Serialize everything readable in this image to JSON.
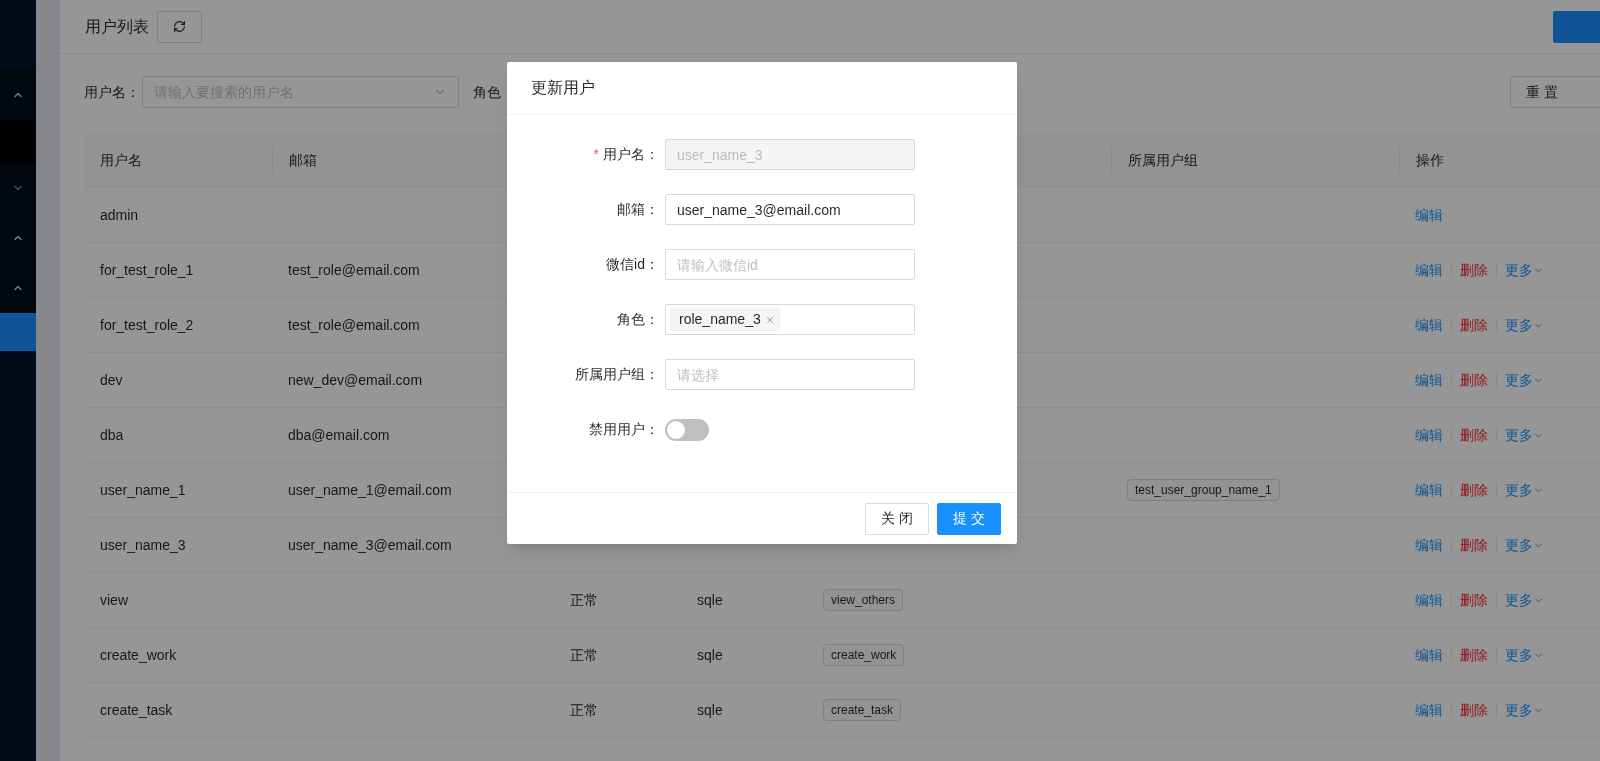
{
  "sidebar": {
    "items": [
      {
        "kind": "submenu",
        "expanded": true
      },
      {
        "kind": "item",
        "selected": false
      },
      {
        "kind": "submenu",
        "expanded": false
      },
      {
        "kind": "submenu",
        "expanded": true
      },
      {
        "kind": "submenu",
        "expanded": true
      },
      {
        "kind": "item",
        "selected": true
      }
    ]
  },
  "header": {
    "title": "用户列表"
  },
  "filters": {
    "username": {
      "label": "用户名：",
      "placeholder": "请输入要搜索的用户名"
    },
    "role_label": "角色",
    "reset_button": "重 置"
  },
  "table": {
    "columns": [
      "用户名",
      "邮箱",
      "所属用户组",
      "操作"
    ],
    "rows": [
      {
        "username": "admin",
        "actions": [
          {
            "kind": "edit",
            "label": "编辑"
          }
        ]
      },
      {
        "username": "for_test_role_1",
        "email": "test_role@email.com",
        "actions": [
          {
            "kind": "edit",
            "label": "编辑"
          },
          {
            "kind": "delete",
            "label": "删除"
          },
          {
            "kind": "more",
            "label": "更多"
          }
        ]
      },
      {
        "username": "for_test_role_2",
        "email": "test_role@email.com",
        "actions": [
          {
            "kind": "edit",
            "label": "编辑"
          },
          {
            "kind": "delete",
            "label": "删除"
          },
          {
            "kind": "more",
            "label": "更多"
          }
        ]
      },
      {
        "username": "dev",
        "email": "new_dev@email.com",
        "actions": [
          {
            "kind": "edit",
            "label": "编辑"
          },
          {
            "kind": "delete",
            "label": "删除"
          },
          {
            "kind": "more",
            "label": "更多"
          }
        ]
      },
      {
        "username": "dba",
        "email": "dba@email.com",
        "actions": [
          {
            "kind": "edit",
            "label": "编辑"
          },
          {
            "kind": "delete",
            "label": "删除"
          },
          {
            "kind": "more",
            "label": "更多"
          }
        ]
      },
      {
        "username": "user_name_1",
        "email": "user_name_1@email.com",
        "groups": [
          "test_user_group_name_1"
        ],
        "actions": [
          {
            "kind": "edit",
            "label": "编辑"
          },
          {
            "kind": "delete",
            "label": "删除"
          },
          {
            "kind": "more",
            "label": "更多"
          }
        ]
      },
      {
        "username": "user_name_3",
        "email": "user_name_3@email.com",
        "actions": [
          {
            "kind": "edit",
            "label": "编辑"
          },
          {
            "kind": "delete",
            "label": "删除"
          },
          {
            "kind": "more",
            "label": "更多"
          }
        ]
      },
      {
        "username": "view",
        "status": "正常",
        "platform": "sqle",
        "roles": [
          "view_others"
        ],
        "actions": [
          {
            "kind": "edit",
            "label": "编辑"
          },
          {
            "kind": "delete",
            "label": "删除"
          },
          {
            "kind": "more",
            "label": "更多"
          }
        ]
      },
      {
        "username": "create_work",
        "status": "正常",
        "platform": "sqle",
        "roles": [
          "create_work"
        ],
        "actions": [
          {
            "kind": "edit",
            "label": "编辑"
          },
          {
            "kind": "delete",
            "label": "删除"
          },
          {
            "kind": "more",
            "label": "更多"
          }
        ]
      },
      {
        "username": "create_task",
        "status": "正常",
        "platform": "sqle",
        "roles": [
          "create_task"
        ],
        "actions": [
          {
            "kind": "edit",
            "label": "编辑"
          },
          {
            "kind": "delete",
            "label": "删除"
          },
          {
            "kind": "more",
            "label": "更多"
          }
        ]
      }
    ]
  },
  "modal": {
    "title": "更新用户",
    "fields": [
      {
        "kind": "input",
        "label": "用户名：",
        "required_mark": "*",
        "disabled": true,
        "value": "user_name_3"
      },
      {
        "kind": "input",
        "label": "邮箱：",
        "disabled": false,
        "value": "user_name_3@email.com"
      },
      {
        "kind": "input",
        "label": "微信id：",
        "placeholder": "请输入微信id"
      },
      {
        "kind": "tags",
        "label": "角色：",
        "tags": [
          "role_name_3"
        ]
      },
      {
        "kind": "input",
        "label": "所属用户组：",
        "placeholder": "请选择"
      },
      {
        "kind": "switch",
        "label": "禁用用户：",
        "on": false
      }
    ],
    "buttons": [
      {
        "label": "关 闭",
        "primary": false
      },
      {
        "label": "提 交",
        "primary": true
      }
    ]
  }
}
